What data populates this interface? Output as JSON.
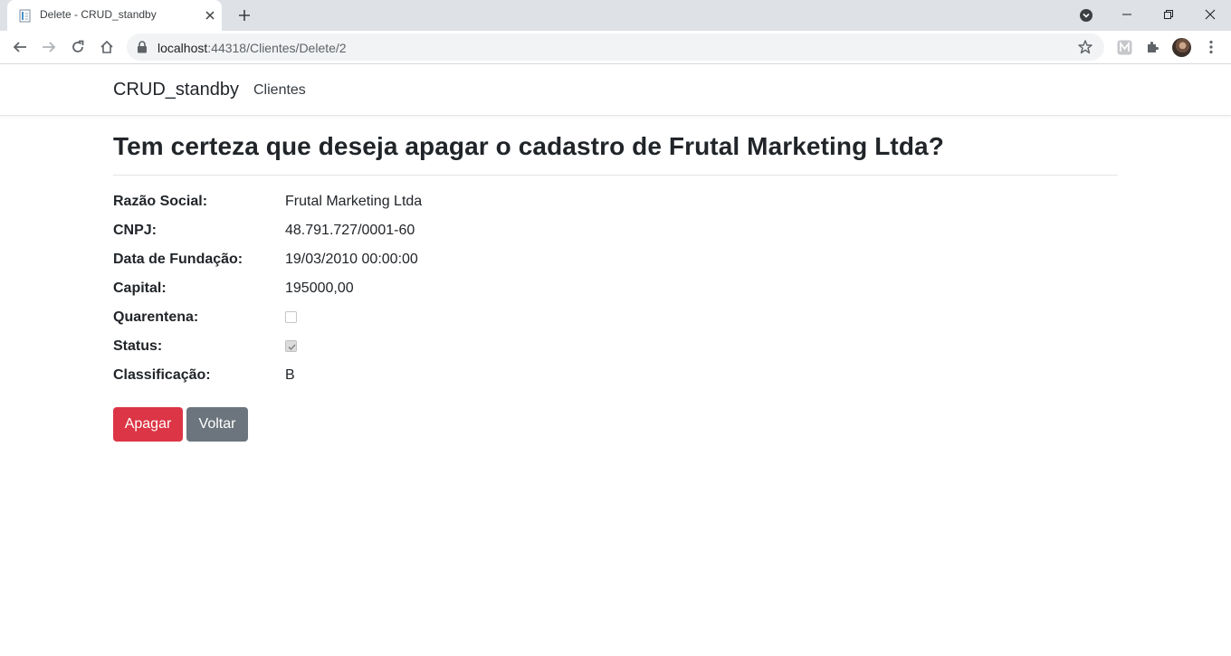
{
  "browser": {
    "tab_title": "Delete - CRUD_standby",
    "url_host": "localhost",
    "url_rest": ":44318/Clientes/Delete/2"
  },
  "navbar": {
    "brand": "CRUD_standby",
    "links": [
      "Clientes"
    ]
  },
  "page": {
    "heading": "Tem certeza que deseja apagar o cadastro de Frutal Marketing Ltda?",
    "fields": [
      {
        "label": "Razão Social:",
        "value": "Frutal Marketing Ltda"
      },
      {
        "label": "CNPJ:",
        "value": "48.791.727/0001-60"
      },
      {
        "label": "Data de Fundação:",
        "value": "19/03/2010 00:00:00"
      },
      {
        "label": "Capital:",
        "value": "195000,00"
      },
      {
        "label": "Quarentena:",
        "checked": false
      },
      {
        "label": "Status:",
        "checked": true
      },
      {
        "label": "Classificação:",
        "value": "B"
      }
    ],
    "buttons": {
      "delete": "Apagar",
      "back": "Voltar"
    }
  },
  "colors": {
    "danger": "#dc3545",
    "secondary": "#6c757d",
    "tabstrip": "#dee1e6"
  }
}
